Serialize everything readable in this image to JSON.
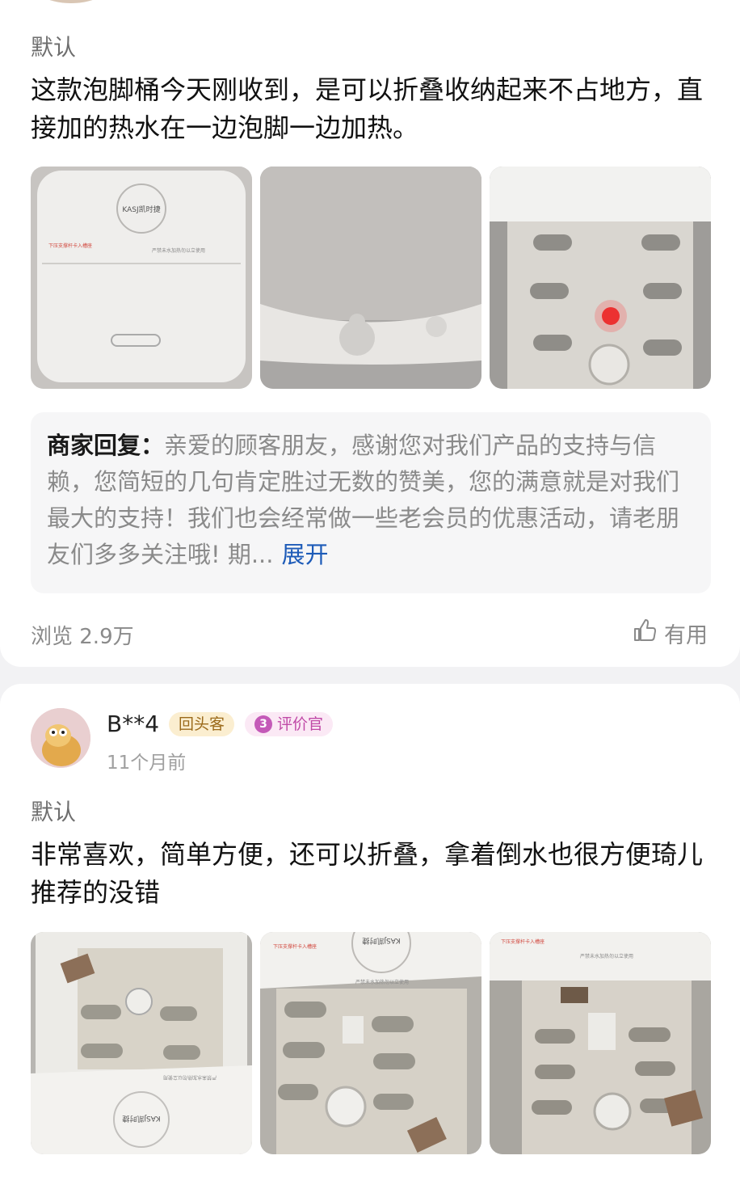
{
  "review1": {
    "spec": "默认",
    "text": "这款泡脚桶今天刚收到，是可以折叠收纳起来不占地方，直接加的热水在一边泡脚一边加热。",
    "reply_label": "商家回复：",
    "reply_text": "亲爱的顾客朋友，感谢您对我们产品的支持与信赖，您简短的几句肯定胜过无数的赞美，您的满意就是对我们最大的支持！我们也会经常做一些老会员的优惠活动，请老朋友们多多关注哦! 期...",
    "expand_label": "展开",
    "views": "浏览 2.9万",
    "useful_label": "有用",
    "photo_text": {
      "logo": "KASJ凯时捷",
      "warning": "下压支撑杆卡入槽座",
      "notice": "严禁未水加热勿以立使用"
    }
  },
  "review2": {
    "user_name": "B**4",
    "badge_return": "回头客",
    "badge_reviewer_level": "3",
    "badge_reviewer": "评价官",
    "time": "11个月前",
    "spec": "默认",
    "text": "非常喜欢，简单方便，还可以折叠，拿着倒水也很方便琦儿推荐的没错",
    "photo_text": {
      "logo": "KASJ凯时捷",
      "warning": "下压支撑杆卡入槽座",
      "notice": "严禁未水加热勿以立使用"
    }
  },
  "colors": {
    "link": "#1d5bb8",
    "secondary_text": "#8a8a8a",
    "badge_return_bg": "#fbeed0",
    "badge_reviewer_bg": "#fbe9f5"
  },
  "icons": [
    "thumbs-up-icon",
    "reviewer-level-icon"
  ]
}
